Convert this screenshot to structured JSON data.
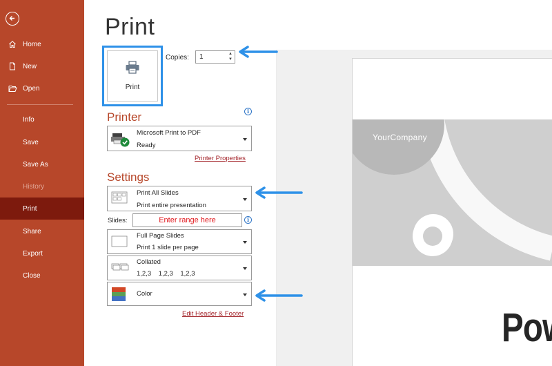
{
  "sidebar": {
    "items": [
      {
        "label": "Home",
        "icon": "home-icon"
      },
      {
        "label": "New",
        "icon": "new-document-icon"
      },
      {
        "label": "Open",
        "icon": "open-folder-icon"
      },
      {
        "label": "Info"
      },
      {
        "label": "Save"
      },
      {
        "label": "Save As"
      },
      {
        "label": "History"
      },
      {
        "label": "Print"
      },
      {
        "label": "Share"
      },
      {
        "label": "Export"
      },
      {
        "label": "Close"
      }
    ]
  },
  "page": {
    "title": "Print"
  },
  "print_button": {
    "label": "Print"
  },
  "copies": {
    "label": "Copies:",
    "value": "1"
  },
  "printer": {
    "heading": "Printer",
    "name": "Microsoft Print to PDF",
    "status": "Ready",
    "properties_link": "Printer Properties"
  },
  "settings": {
    "heading": "Settings",
    "range": {
      "line1": "Print All Slides",
      "line2": "Print entire presentation"
    },
    "slides_label": "Slides:",
    "slides_input": "Enter range here",
    "layout": {
      "line1": "Full Page Slides",
      "line2": "Print 1 slide per page"
    },
    "collation": {
      "line1": "Collated",
      "line2": "1,2,3    1,2,3    1,2,3"
    },
    "color": {
      "line1": "Color"
    },
    "header_footer_link": "Edit Header & Footer"
  },
  "preview": {
    "company": "YourCompany",
    "big_text": "Pow"
  },
  "colors": {
    "accent": "#b7472a",
    "active_nav": "#7d1a0d",
    "annotation_arrow": "#2e91e8",
    "range_text": "#e0161b"
  }
}
